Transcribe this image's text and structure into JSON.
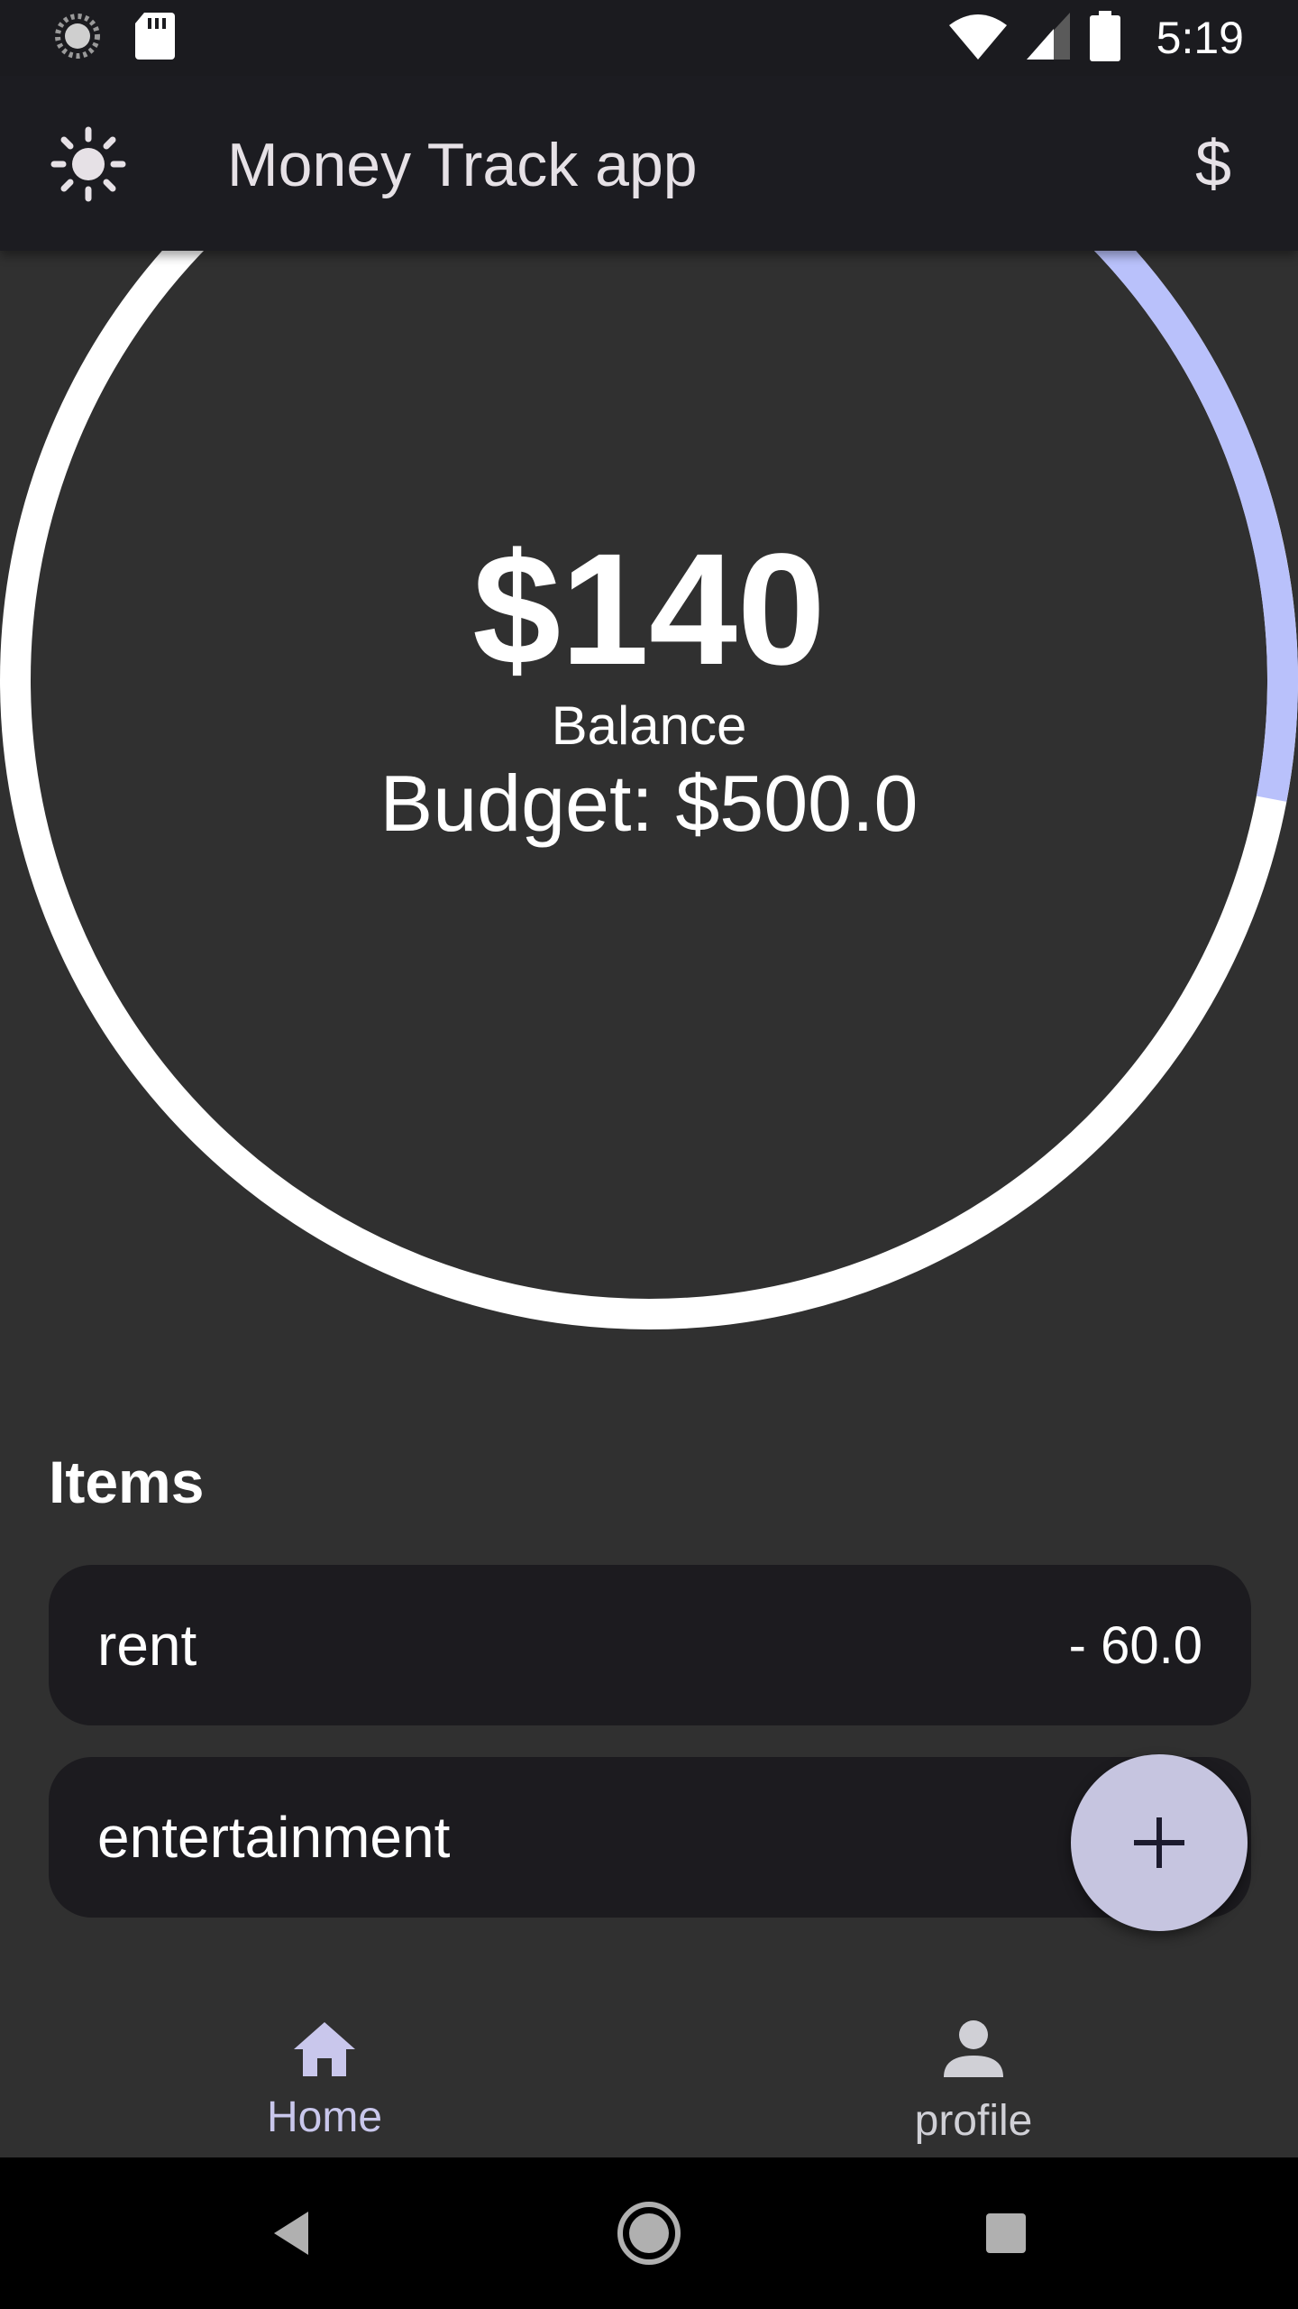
{
  "status_bar": {
    "time": "5:19",
    "icons": [
      "sync-icon",
      "sd-card-icon",
      "wifi-icon",
      "signal-icon",
      "battery-icon"
    ]
  },
  "app_bar": {
    "title": "Money Track app",
    "theme_icon": "sun-icon",
    "currency_symbol": "$"
  },
  "summary": {
    "balance": "$140",
    "balance_label": "Balance",
    "budget": "Budget: $500.0",
    "spent_fraction": 0.72
  },
  "items": {
    "heading": "Items",
    "list": [
      {
        "name": "rent",
        "amount": "- 60.0"
      },
      {
        "name": "entertainment",
        "amount": ""
      }
    ]
  },
  "fab": {
    "icon": "plus-icon"
  },
  "bottom_nav": {
    "items": [
      {
        "label": "Home",
        "icon": "home-icon",
        "selected": true
      },
      {
        "label": "profile",
        "icon": "person-icon",
        "selected": false
      }
    ]
  },
  "colors": {
    "background": "#303030",
    "bar": "#1c1c21",
    "card": "#1c1b1f",
    "accent": "#b9c1fb",
    "fab": "#c6c5e0",
    "nav_selected": "#c9c7ec"
  }
}
